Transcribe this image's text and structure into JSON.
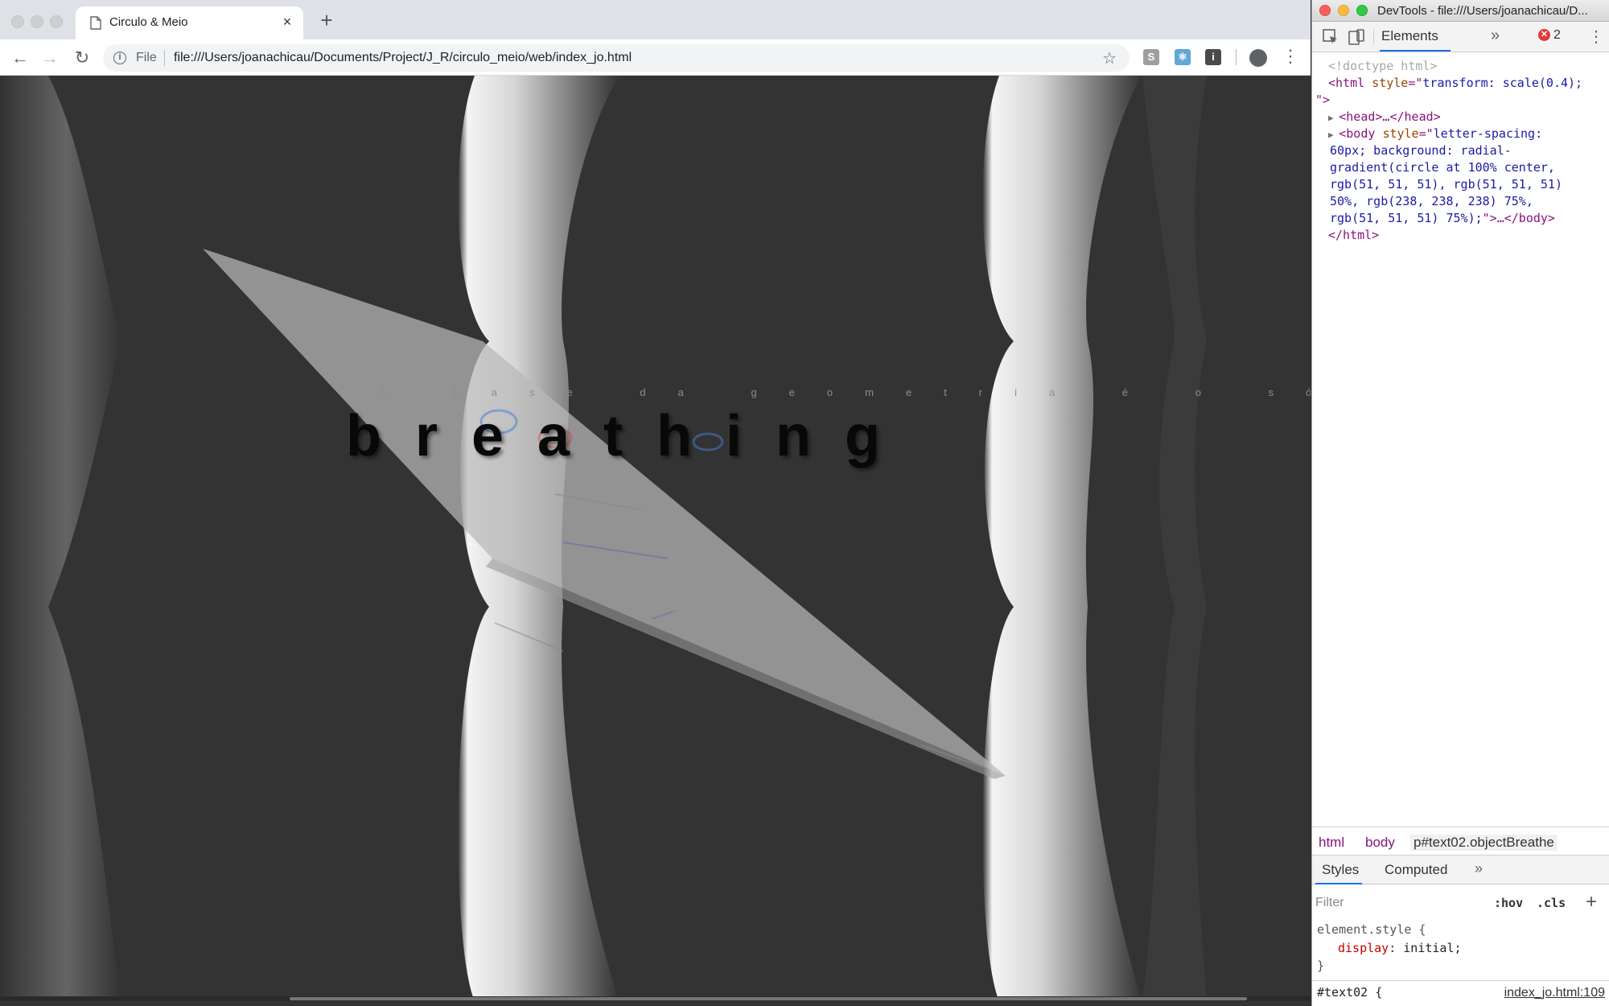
{
  "browser": {
    "tab_title": "Circulo & Meio",
    "tab_close_glyph": "×",
    "new_tab_glyph": "+",
    "back_glyph": "←",
    "forward_glyph": "→",
    "reload_glyph": "↻",
    "address": {
      "scheme_label": "File",
      "url": "file:///Users/joanachicau/Documents/Project/J_R/circulo_meio/web/index_jo.html"
    },
    "bookmark_glyph": "☆",
    "menu_glyph": "⋮",
    "extensions": [
      {
        "name": "s-extension-icon",
        "glyph": "S",
        "color": "#9e9e9e"
      },
      {
        "name": "react-extension-icon",
        "glyph": "⚛",
        "color": "#61a8d6"
      },
      {
        "name": "info-extension-icon",
        "glyph": "i",
        "color": "#4a4a4a"
      }
    ]
  },
  "page": {
    "paragraph": "A base da geometria é o sólido, con",
    "heading": "breathing",
    "colors": {
      "background": "#333333",
      "light_stripe": "#eeeeee"
    }
  },
  "devtools": {
    "window_title": "DevTools - file:///Users/joanachicau/D...",
    "panel_tab": "Elements",
    "more_glyph": "»",
    "error_count": "2",
    "error_glyph": "✕",
    "menu_glyph": "⋮",
    "dom": {
      "doctype": "<!doctype html>",
      "html_open": "<html",
      "html_attr": "style",
      "html_style": "transform: scale(0.4);",
      "html_tail": "\">",
      "head": "<head>…</head>",
      "body_open": "<body",
      "body_attr": "style",
      "body_style_lines": [
        "letter-spacing:",
        "60px; background: radial-",
        "gradient(circle at 100% center,",
        "rgb(51, 51, 51), rgb(51, 51, 51)",
        "50%, rgb(238, 238, 238) 75%,",
        "rgb(51, 51, 51) 75%);"
      ],
      "body_close": "\">…</body>",
      "html_close": "</html>"
    },
    "breadcrumbs": [
      "html",
      "body",
      "p#text02.objectBreathe"
    ],
    "styles_tabs": [
      "Styles",
      "Computed"
    ],
    "filter_placeholder": "Filter",
    "hov": ":hov",
    "cls": ".cls",
    "add_rule": "+",
    "rules": {
      "element_selector": "element.style {",
      "prop": "display",
      "value": "initial;",
      "close": "}",
      "next_selector": "#text02 {",
      "source_link": "index_jo.html:109"
    }
  }
}
